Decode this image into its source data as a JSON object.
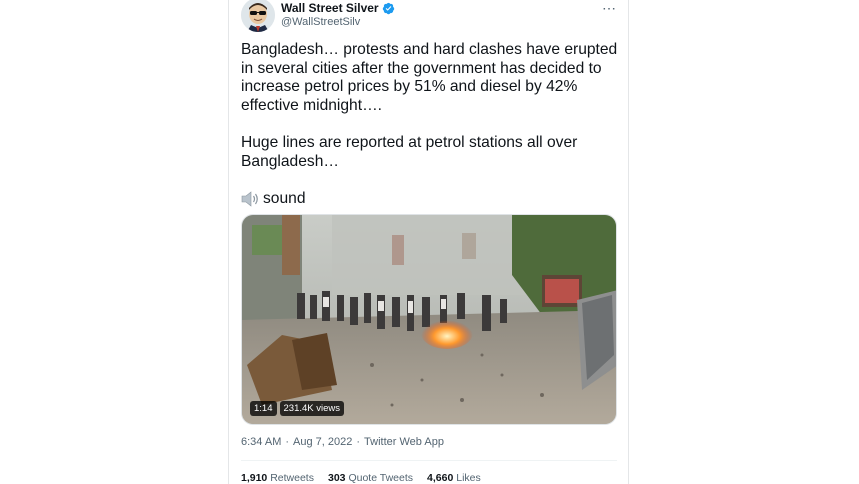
{
  "tweet": {
    "author": {
      "display_name": "Wall Street Silver",
      "handle": "@WallStreetSilv",
      "verified": true,
      "avatar_icon": "avatar-cartoon-sunglasses-icon"
    },
    "more_icon": "more-options-icon",
    "text_paragraph_1": "Bangladesh… protests and hard clashes have erupted in several cities after the government has decided to increase petrol prices by 51% and diesel by 42% effective midnight….",
    "text_paragraph_2": "Huge lines are reported at petrol stations all over Bangladesh…",
    "text_paragraph_3_emoji": "speaker-icon",
    "text_paragraph_3": "sound",
    "media": {
      "type": "video",
      "duration": "1:14",
      "views": "231.4K views"
    },
    "timestamp": {
      "time": "6:34 AM",
      "separator_1": "·",
      "date": "Aug 7, 2022",
      "separator_2": "·",
      "source": "Twitter Web App"
    },
    "stats": {
      "retweets_count": "1,910",
      "retweets_label": "Retweets",
      "quotes_count": "303",
      "quotes_label": "Quote Tweets",
      "likes_count": "4,660",
      "likes_label": "Likes"
    },
    "colors": {
      "text_primary": "#0f1419",
      "text_secondary": "#536471",
      "verified_blue": "#1d9bf0"
    }
  }
}
